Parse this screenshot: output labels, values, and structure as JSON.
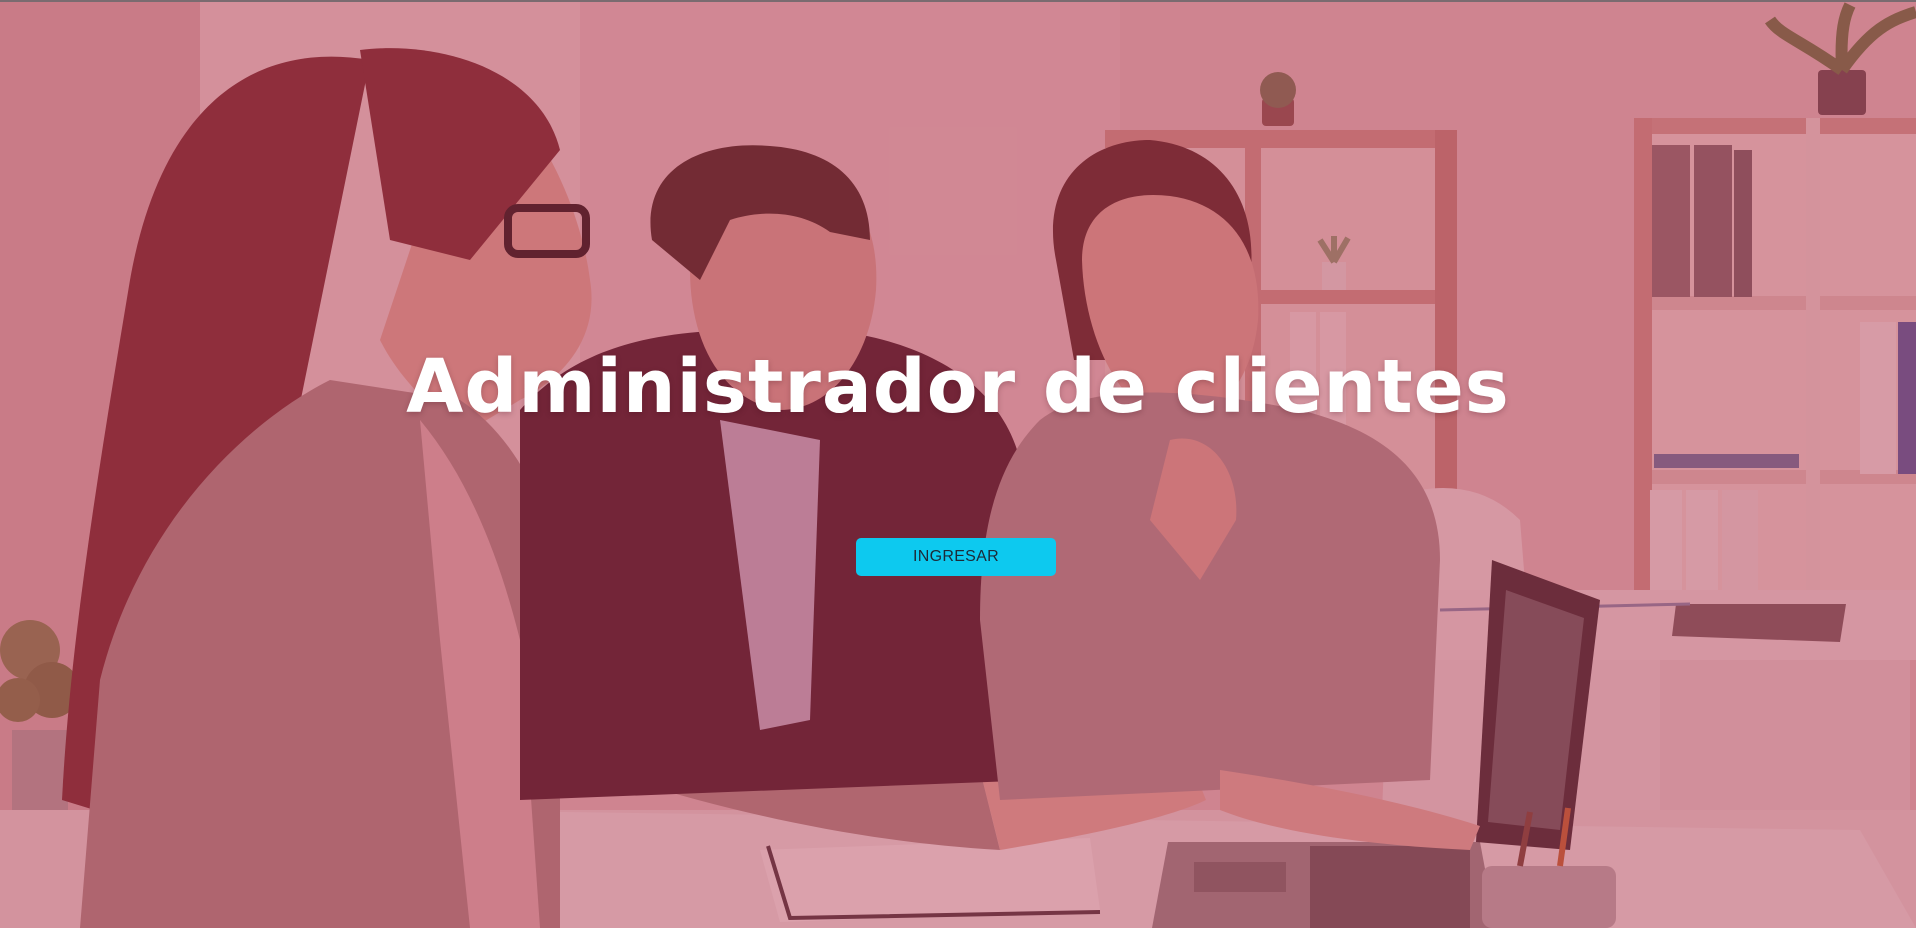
{
  "hero": {
    "title": "Administrador de clientes",
    "button_label": "INGRESAR"
  },
  "colors": {
    "overlay_tint": "#ab2e48",
    "button_background": "#0dc9ef",
    "button_text": "#1c2a38",
    "title_text": "#ffffff"
  },
  "background_image": {
    "depicts": "three people meeting at an office desk looking at a laptop",
    "icons": [
      "laptop-icon",
      "potted-plant-icon",
      "binder-icon",
      "pen-icon"
    ]
  }
}
